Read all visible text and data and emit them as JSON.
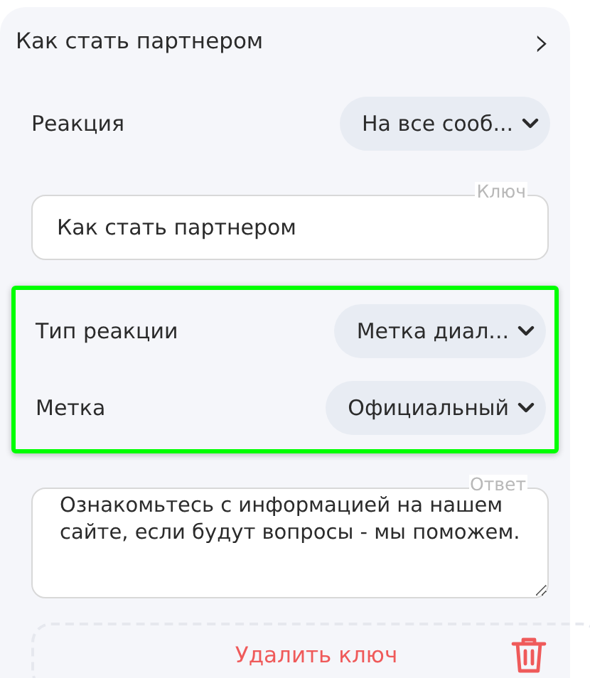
{
  "header": {
    "title": "Как стать партнером",
    "chevron": "›"
  },
  "reaction": {
    "label": "Реакция",
    "value": "На все сооб..."
  },
  "key_field": {
    "legend": "Ключ",
    "value": "Как стать партнером"
  },
  "highlighted_group": {
    "highlighted": true,
    "color": "#00ff00",
    "rows": [
      {
        "label": "Тип реакции",
        "value": "Метка диал..."
      },
      {
        "label": "Метка",
        "value": "Официальный"
      }
    ]
  },
  "answer_field": {
    "legend": "Ответ",
    "value": "Ознакомьтесь с информацией на нашем сайте, если будут вопросы - мы поможем."
  },
  "delete_button": {
    "label": "Удалить ключ"
  }
}
